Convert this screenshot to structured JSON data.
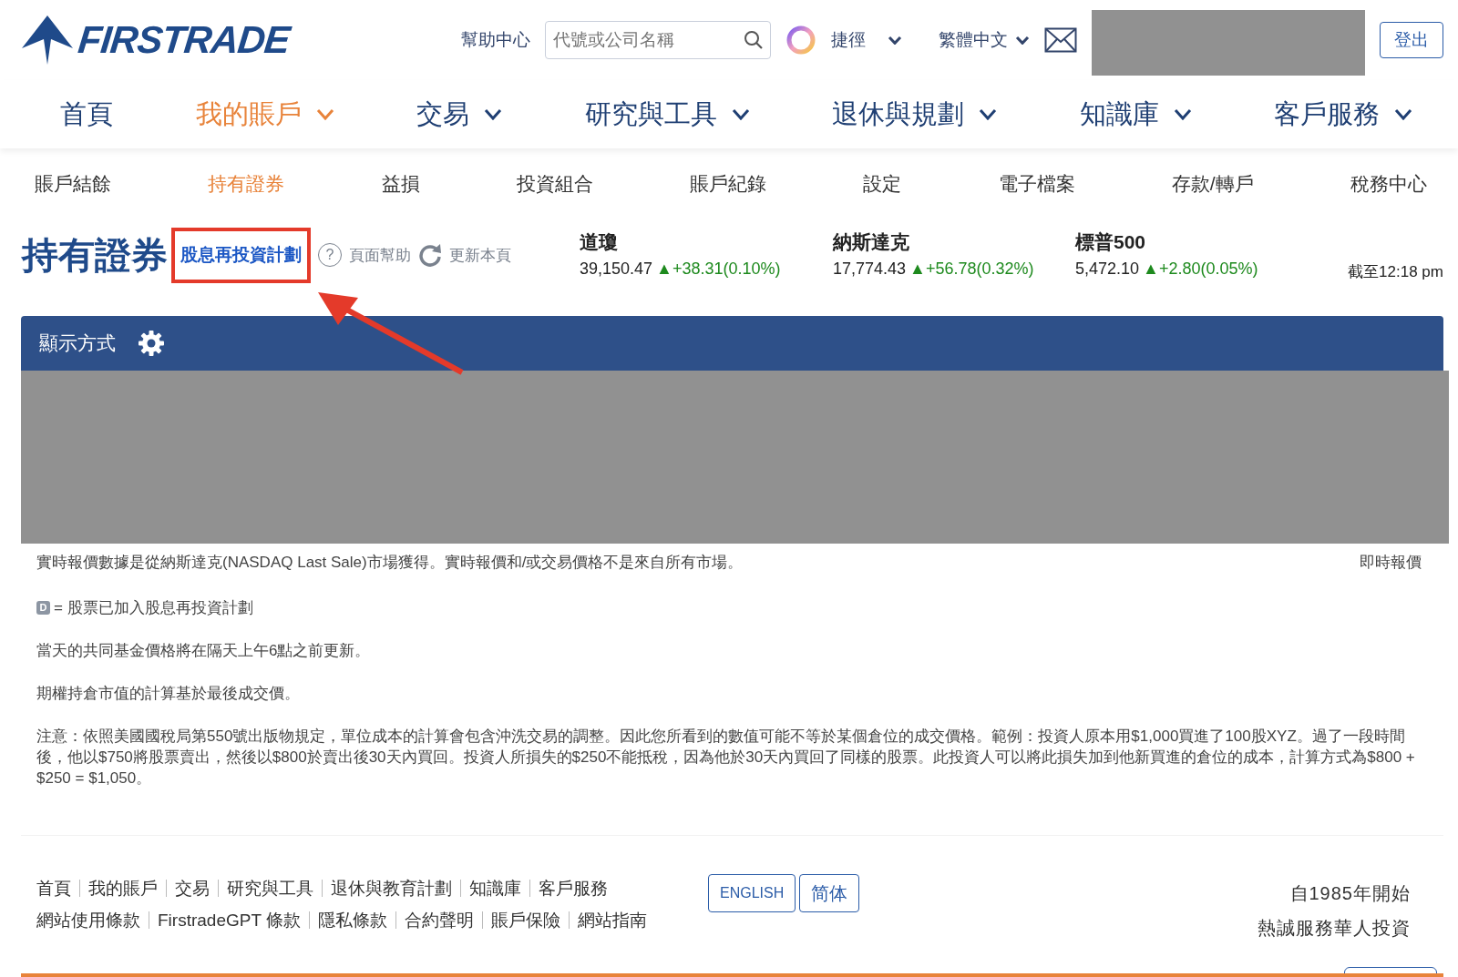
{
  "header": {
    "logo": "FIRSTRADE",
    "help": "幫助中心",
    "search": {
      "placeholder": "代號或公司名稱"
    },
    "shortcuts": "捷徑",
    "language": "繁體中文",
    "account_redacted": true,
    "logout": "登出"
  },
  "main_nav": [
    {
      "label": "首頁",
      "selected": false,
      "dropdown": false
    },
    {
      "label": "我的賬戶",
      "selected": true,
      "dropdown": true
    },
    {
      "label": "交易",
      "selected": false,
      "dropdown": true
    },
    {
      "label": "研究與工具",
      "selected": false,
      "dropdown": true
    },
    {
      "label": "退休與規劃",
      "selected": false,
      "dropdown": true
    },
    {
      "label": "知識庫",
      "selected": false,
      "dropdown": true
    },
    {
      "label": "客戶服務",
      "selected": false,
      "dropdown": true
    }
  ],
  "sub_nav": [
    {
      "label": "賬戶結餘",
      "selected": false
    },
    {
      "label": "持有證券",
      "selected": true
    },
    {
      "label": "益損",
      "selected": false
    },
    {
      "label": "投資組合",
      "selected": false
    },
    {
      "label": "賬戶紀錄",
      "selected": false
    },
    {
      "label": "設定",
      "selected": false
    },
    {
      "label": "電子檔案",
      "selected": false
    },
    {
      "label": "存款/轉戶",
      "selected": false
    },
    {
      "label": "稅務中心",
      "selected": false
    }
  ],
  "page": {
    "title": "持有證券",
    "drip_link": {
      "label": "股息再投資計劃",
      "highlighted": true
    },
    "help_icon": "?",
    "page_help": "頁面幫助",
    "refresh": "更新本頁"
  },
  "indices": [
    {
      "name": "道瓊",
      "value": "39,150.47",
      "change": "▲+38.31(0.10%)"
    },
    {
      "name": "納斯達克",
      "value": "17,774.43",
      "change": "▲+56.78(0.32%)"
    },
    {
      "name": "標普500",
      "value": "5,472.10",
      "change": "▲+2.80(0.05%)"
    }
  ],
  "as_of": "截至12:18 pm",
  "panel": {
    "title": "顯示方式",
    "content_redacted": true
  },
  "notes": {
    "quote_source": "實時報價數據是從納斯達克(NASDAQ Last Sale)市場獲得。實時報價和/或交易價格不是來自所有市場。",
    "quote_type": "即時報價",
    "legend_badge": "D",
    "legend_text": "= 股票已加入股息再投資計劃",
    "lines": [
      "當天的共同基金價格將在隔天上午6點之前更新。",
      "期權持倉市值的計算基於最後成交價。",
      "注意：依照美國國稅局第550號出版物規定，單位成本的計算會包含沖洗交易的調整。因此您所看到的數值可能不等於某個倉位的成交價格。範例：投資人原本用$1,000買進了100股XYZ。過了一段時間後，他以$750將股票賣出，然後以$800於賣出後30天內買回。投資人所損失的$250不能抵稅，因為他於30天內買回了同樣的股票。此投資人可以將此損失加到他新買進的倉位的成本，計算方式為$800 + $250 = $1,050。"
    ]
  },
  "footer": {
    "links_row_1": [
      "首頁",
      "我的賬戶",
      "交易",
      "研究與工具",
      "退休與教育計劃",
      "知識庫",
      "客戶服務"
    ],
    "links_row_2": [
      "網站使用條款",
      "FirstradeGPT 條款",
      "隱私條款",
      "合約聲明",
      "賬戶保險",
      "網站指南"
    ],
    "language_buttons": [
      "ENGLISH",
      "简体"
    ],
    "tagline": [
      "自1985年開始",
      "熱誠服務華人投資"
    ]
  }
}
